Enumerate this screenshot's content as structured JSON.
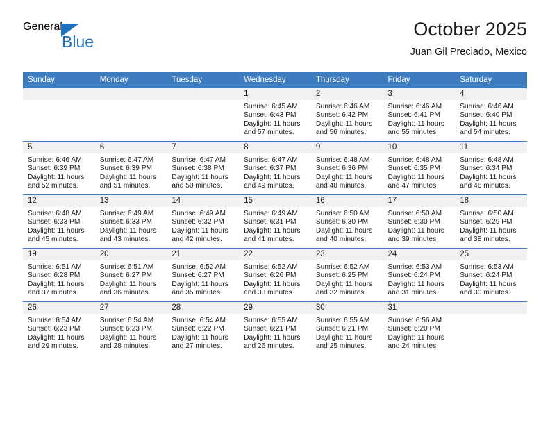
{
  "brand": {
    "name_top": "General",
    "name_bottom": "Blue",
    "accent_color": "#1f72bd"
  },
  "header": {
    "title": "October 2025",
    "subtitle": "Juan Gil Preciado, Mexico"
  },
  "theme": {
    "header_row_color": "#3d7cbf",
    "daynum_band_color": "#f1f1f1",
    "cell_background": "#ffffff",
    "text_color": "#1a1a1a"
  },
  "weekday_headers": [
    "Sunday",
    "Monday",
    "Tuesday",
    "Wednesday",
    "Thursday",
    "Friday",
    "Saturday"
  ],
  "weeks": [
    [
      {
        "day": "",
        "blank": true,
        "sunrise": "",
        "sunset": "",
        "daylight_line1": "",
        "daylight_line2": ""
      },
      {
        "day": "",
        "blank": true,
        "sunrise": "",
        "sunset": "",
        "daylight_line1": "",
        "daylight_line2": ""
      },
      {
        "day": "",
        "blank": true,
        "sunrise": "",
        "sunset": "",
        "daylight_line1": "",
        "daylight_line2": ""
      },
      {
        "day": "1",
        "sunrise": "Sunrise: 6:45 AM",
        "sunset": "Sunset: 6:43 PM",
        "daylight_line1": "Daylight: 11 hours",
        "daylight_line2": "and 57 minutes."
      },
      {
        "day": "2",
        "sunrise": "Sunrise: 6:46 AM",
        "sunset": "Sunset: 6:42 PM",
        "daylight_line1": "Daylight: 11 hours",
        "daylight_line2": "and 56 minutes."
      },
      {
        "day": "3",
        "sunrise": "Sunrise: 6:46 AM",
        "sunset": "Sunset: 6:41 PM",
        "daylight_line1": "Daylight: 11 hours",
        "daylight_line2": "and 55 minutes."
      },
      {
        "day": "4",
        "sunrise": "Sunrise: 6:46 AM",
        "sunset": "Sunset: 6:40 PM",
        "daylight_line1": "Daylight: 11 hours",
        "daylight_line2": "and 54 minutes."
      }
    ],
    [
      {
        "day": "5",
        "sunrise": "Sunrise: 6:46 AM",
        "sunset": "Sunset: 6:39 PM",
        "daylight_line1": "Daylight: 11 hours",
        "daylight_line2": "and 52 minutes."
      },
      {
        "day": "6",
        "sunrise": "Sunrise: 6:47 AM",
        "sunset": "Sunset: 6:39 PM",
        "daylight_line1": "Daylight: 11 hours",
        "daylight_line2": "and 51 minutes."
      },
      {
        "day": "7",
        "sunrise": "Sunrise: 6:47 AM",
        "sunset": "Sunset: 6:38 PM",
        "daylight_line1": "Daylight: 11 hours",
        "daylight_line2": "and 50 minutes."
      },
      {
        "day": "8",
        "sunrise": "Sunrise: 6:47 AM",
        "sunset": "Sunset: 6:37 PM",
        "daylight_line1": "Daylight: 11 hours",
        "daylight_line2": "and 49 minutes."
      },
      {
        "day": "9",
        "sunrise": "Sunrise: 6:48 AM",
        "sunset": "Sunset: 6:36 PM",
        "daylight_line1": "Daylight: 11 hours",
        "daylight_line2": "and 48 minutes."
      },
      {
        "day": "10",
        "sunrise": "Sunrise: 6:48 AM",
        "sunset": "Sunset: 6:35 PM",
        "daylight_line1": "Daylight: 11 hours",
        "daylight_line2": "and 47 minutes."
      },
      {
        "day": "11",
        "sunrise": "Sunrise: 6:48 AM",
        "sunset": "Sunset: 6:34 PM",
        "daylight_line1": "Daylight: 11 hours",
        "daylight_line2": "and 46 minutes."
      }
    ],
    [
      {
        "day": "12",
        "sunrise": "Sunrise: 6:48 AM",
        "sunset": "Sunset: 6:33 PM",
        "daylight_line1": "Daylight: 11 hours",
        "daylight_line2": "and 45 minutes."
      },
      {
        "day": "13",
        "sunrise": "Sunrise: 6:49 AM",
        "sunset": "Sunset: 6:33 PM",
        "daylight_line1": "Daylight: 11 hours",
        "daylight_line2": "and 43 minutes."
      },
      {
        "day": "14",
        "sunrise": "Sunrise: 6:49 AM",
        "sunset": "Sunset: 6:32 PM",
        "daylight_line1": "Daylight: 11 hours",
        "daylight_line2": "and 42 minutes."
      },
      {
        "day": "15",
        "sunrise": "Sunrise: 6:49 AM",
        "sunset": "Sunset: 6:31 PM",
        "daylight_line1": "Daylight: 11 hours",
        "daylight_line2": "and 41 minutes."
      },
      {
        "day": "16",
        "sunrise": "Sunrise: 6:50 AM",
        "sunset": "Sunset: 6:30 PM",
        "daylight_line1": "Daylight: 11 hours",
        "daylight_line2": "and 40 minutes."
      },
      {
        "day": "17",
        "sunrise": "Sunrise: 6:50 AM",
        "sunset": "Sunset: 6:30 PM",
        "daylight_line1": "Daylight: 11 hours",
        "daylight_line2": "and 39 minutes."
      },
      {
        "day": "18",
        "sunrise": "Sunrise: 6:50 AM",
        "sunset": "Sunset: 6:29 PM",
        "daylight_line1": "Daylight: 11 hours",
        "daylight_line2": "and 38 minutes."
      }
    ],
    [
      {
        "day": "19",
        "sunrise": "Sunrise: 6:51 AM",
        "sunset": "Sunset: 6:28 PM",
        "daylight_line1": "Daylight: 11 hours",
        "daylight_line2": "and 37 minutes."
      },
      {
        "day": "20",
        "sunrise": "Sunrise: 6:51 AM",
        "sunset": "Sunset: 6:27 PM",
        "daylight_line1": "Daylight: 11 hours",
        "daylight_line2": "and 36 minutes."
      },
      {
        "day": "21",
        "sunrise": "Sunrise: 6:52 AM",
        "sunset": "Sunset: 6:27 PM",
        "daylight_line1": "Daylight: 11 hours",
        "daylight_line2": "and 35 minutes."
      },
      {
        "day": "22",
        "sunrise": "Sunrise: 6:52 AM",
        "sunset": "Sunset: 6:26 PM",
        "daylight_line1": "Daylight: 11 hours",
        "daylight_line2": "and 33 minutes."
      },
      {
        "day": "23",
        "sunrise": "Sunrise: 6:52 AM",
        "sunset": "Sunset: 6:25 PM",
        "daylight_line1": "Daylight: 11 hours",
        "daylight_line2": "and 32 minutes."
      },
      {
        "day": "24",
        "sunrise": "Sunrise: 6:53 AM",
        "sunset": "Sunset: 6:24 PM",
        "daylight_line1": "Daylight: 11 hours",
        "daylight_line2": "and 31 minutes."
      },
      {
        "day": "25",
        "sunrise": "Sunrise: 6:53 AM",
        "sunset": "Sunset: 6:24 PM",
        "daylight_line1": "Daylight: 11 hours",
        "daylight_line2": "and 30 minutes."
      }
    ],
    [
      {
        "day": "26",
        "sunrise": "Sunrise: 6:54 AM",
        "sunset": "Sunset: 6:23 PM",
        "daylight_line1": "Daylight: 11 hours",
        "daylight_line2": "and 29 minutes."
      },
      {
        "day": "27",
        "sunrise": "Sunrise: 6:54 AM",
        "sunset": "Sunset: 6:23 PM",
        "daylight_line1": "Daylight: 11 hours",
        "daylight_line2": "and 28 minutes."
      },
      {
        "day": "28",
        "sunrise": "Sunrise: 6:54 AM",
        "sunset": "Sunset: 6:22 PM",
        "daylight_line1": "Daylight: 11 hours",
        "daylight_line2": "and 27 minutes."
      },
      {
        "day": "29",
        "sunrise": "Sunrise: 6:55 AM",
        "sunset": "Sunset: 6:21 PM",
        "daylight_line1": "Daylight: 11 hours",
        "daylight_line2": "and 26 minutes."
      },
      {
        "day": "30",
        "sunrise": "Sunrise: 6:55 AM",
        "sunset": "Sunset: 6:21 PM",
        "daylight_line1": "Daylight: 11 hours",
        "daylight_line2": "and 25 minutes."
      },
      {
        "day": "31",
        "sunrise": "Sunrise: 6:56 AM",
        "sunset": "Sunset: 6:20 PM",
        "daylight_line1": "Daylight: 11 hours",
        "daylight_line2": "and 24 minutes."
      },
      {
        "day": "",
        "blank": true,
        "sunrise": "",
        "sunset": "",
        "daylight_line1": "",
        "daylight_line2": ""
      }
    ]
  ]
}
